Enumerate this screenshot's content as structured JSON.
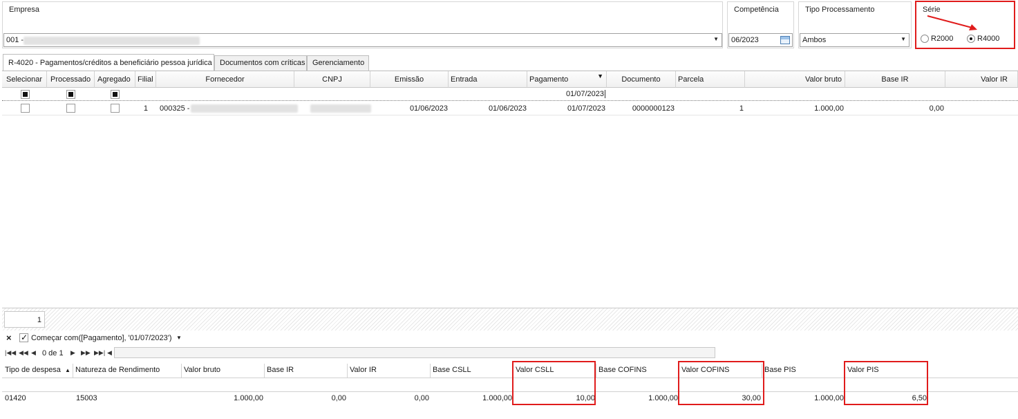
{
  "empresa": {
    "label": "Empresa",
    "value": "001 -"
  },
  "competencia": {
    "label": "Competência",
    "value": "06/2023"
  },
  "tipo_processamento": {
    "label": "Tipo Processamento",
    "value": "Ambos"
  },
  "serie": {
    "label": "Série",
    "options": [
      "R2000",
      "R4000"
    ],
    "selected": "R4000"
  },
  "tabs": [
    {
      "label": "R-4020 - Pagamentos/créditos a beneficiário pessoa jurídica",
      "active": true
    },
    {
      "label": "Documentos com críticas",
      "active": false
    },
    {
      "label": "Gerenciamento",
      "active": false
    }
  ],
  "main_grid": {
    "columns": [
      "Selecionar",
      "Processado",
      "Agregado",
      "Filial",
      "Fornecedor",
      "CNPJ",
      "Emissão",
      "Entrada",
      "Pagamento",
      "Documento",
      "Parcela",
      "Valor bruto",
      "Base IR",
      "Valor IR"
    ],
    "filter_row": {
      "pagamento": "01/07/2023"
    },
    "rows": [
      {
        "filial": "1",
        "fornecedor": "000325 -",
        "emissao": "01/06/2023",
        "entrada": "01/06/2023",
        "pagamento": "01/07/2023",
        "documento": "0000000123",
        "parcela": "1",
        "valor_bruto": "1.000,00",
        "base_ir": "0,00",
        "valor_ir": ""
      }
    ]
  },
  "footer_count": "1",
  "filter_bar": {
    "text": "Começar com([Pagamento], '01/07/2023')"
  },
  "navigator": {
    "position": "0 de 1"
  },
  "detail_grid": {
    "columns": [
      "Tipo de despesa",
      "Natureza de Rendimento",
      "Valor bruto",
      "Base IR",
      "Valor IR",
      "Base CSLL",
      "Valor CSLL",
      "Base COFINS",
      "Valor COFINS",
      "Base PIS",
      "Valor PIS"
    ],
    "rows": [
      {
        "tipo_despesa": "01420",
        "natureza": "15003",
        "valor_bruto": "1.000,00",
        "base_ir": "0,00",
        "valor_ir": "0,00",
        "base_csll": "1.000,00",
        "valor_csll": "10,00",
        "base_cofins": "1.000,00",
        "valor_cofins": "30,00",
        "base_pis": "1.000,00",
        "valor_pis": "6,50"
      }
    ]
  },
  "colors": {
    "highlight": "#e01b1b",
    "border": "#bdbdbd"
  }
}
